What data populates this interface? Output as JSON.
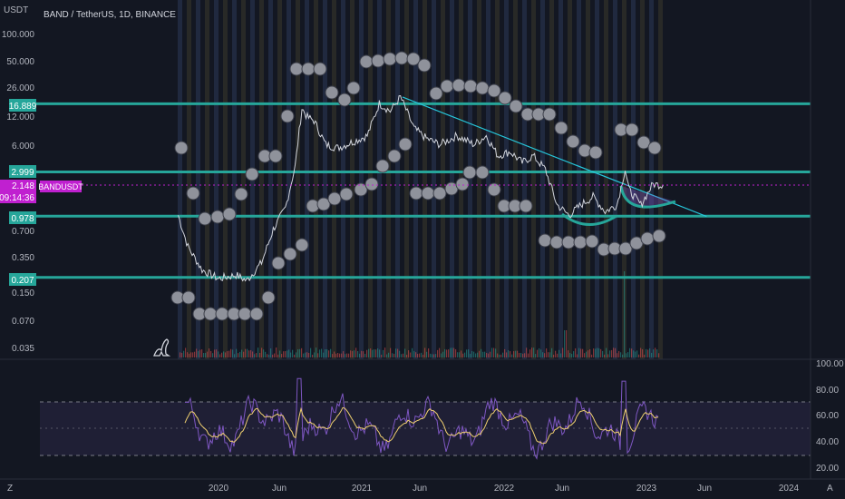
{
  "header": {
    "currency": "USDT",
    "symbol_title": "BAND / TetherUS, 1D, BINANCE"
  },
  "price_axis": {
    "ticks": [
      "100.000",
      "50.000",
      "26.000",
      "12.000",
      "6.000",
      "2.999",
      "0.978",
      "0.700",
      "0.350",
      "0.207",
      "0.150",
      "0.070",
      "0.035"
    ],
    "levels": [
      {
        "label": "16.889",
        "value": 16.889
      },
      {
        "label": "2.999",
        "value": 2.999
      },
      {
        "label": "0.978",
        "value": 0.978
      },
      {
        "label": "0.207",
        "value": 0.207
      }
    ],
    "current": {
      "price": "2.148",
      "countdown": "09:14:36",
      "symbol": "BANDUSDT",
      "value": 2.148
    }
  },
  "rsi_axis": {
    "ticks": [
      "100.00",
      "80.00",
      "60.00",
      "40.00",
      "20.00"
    ],
    "upper": 70,
    "middle": 50,
    "lower": 30
  },
  "time_axis": {
    "ticks": [
      "2020",
      "Jun",
      "2021",
      "Jun",
      "2022",
      "Jun",
      "2023",
      "Jun",
      "2024"
    ]
  },
  "footer": {
    "left": "Z",
    "right": "A"
  },
  "colors": {
    "background": "#131722",
    "level": "#26a69a",
    "trendline": "#26c6da",
    "price_line": "#c020d0",
    "rsi": "#7e57c2",
    "rsi_ma": "#f0d070",
    "circle": "#9598a1"
  },
  "chart_data": {
    "type": "line",
    "title": "BAND / TetherUS, 1D, BINANCE",
    "ylabel": "USDT",
    "yscale": "log",
    "series": [
      {
        "name": "BANDUSDT",
        "x": [
          "2019-09-20",
          "2019-10-15",
          "2019-11-20",
          "2020-01-01",
          "2020-02-15",
          "2020-03-13",
          "2020-04-20",
          "2020-05-20",
          "2020-06-20",
          "2020-07-15",
          "2020-08-01",
          "2020-08-15",
          "2020-09-01",
          "2020-10-01",
          "2020-11-01",
          "2020-12-01",
          "2021-01-15",
          "2021-02-15",
          "2021-03-15",
          "2021-04-10",
          "2021-05-15",
          "2021-06-15",
          "2021-07-20",
          "2021-09-01",
          "2021-10-15",
          "2021-11-15",
          "2021-12-15",
          "2022-01-15",
          "2022-02-15",
          "2022-03-15",
          "2022-04-15",
          "2022-05-15",
          "2022-06-15",
          "2022-07-15",
          "2022-08-15",
          "2022-09-15",
          "2022-10-15",
          "2022-11-05",
          "2022-11-15",
          "2022-12-15",
          "2023-01-15",
          "2023-02-10"
        ],
        "y": [
          1.0,
          0.45,
          0.25,
          0.2,
          0.22,
          0.19,
          0.3,
          0.7,
          1.2,
          3.5,
          15,
          12,
          11,
          6,
          5.5,
          6.2,
          7.5,
          17,
          14,
          20,
          9,
          7,
          6,
          7.5,
          6,
          7.5,
          4.5,
          5,
          3.8,
          4.5,
          3.2,
          1.3,
          1.0,
          1.3,
          1.6,
          1.1,
          1.3,
          3.2,
          1.9,
          1.3,
          2.2,
          2.148
        ]
      }
    ],
    "rsi": {
      "name": "RSI",
      "ylim": [
        20,
        100
      ]
    },
    "horizontal_levels": [
      16.889,
      2.999,
      0.978,
      0.207
    ],
    "trendline": {
      "from": {
        "x": "2021-04-15",
        "y": 20
      },
      "to": {
        "x": "2023-06-01",
        "y": 0.97
      }
    },
    "ylim": [
      0.03,
      120
    ],
    "xlim": [
      "2019-08-01",
      "2024-05-01"
    ]
  }
}
